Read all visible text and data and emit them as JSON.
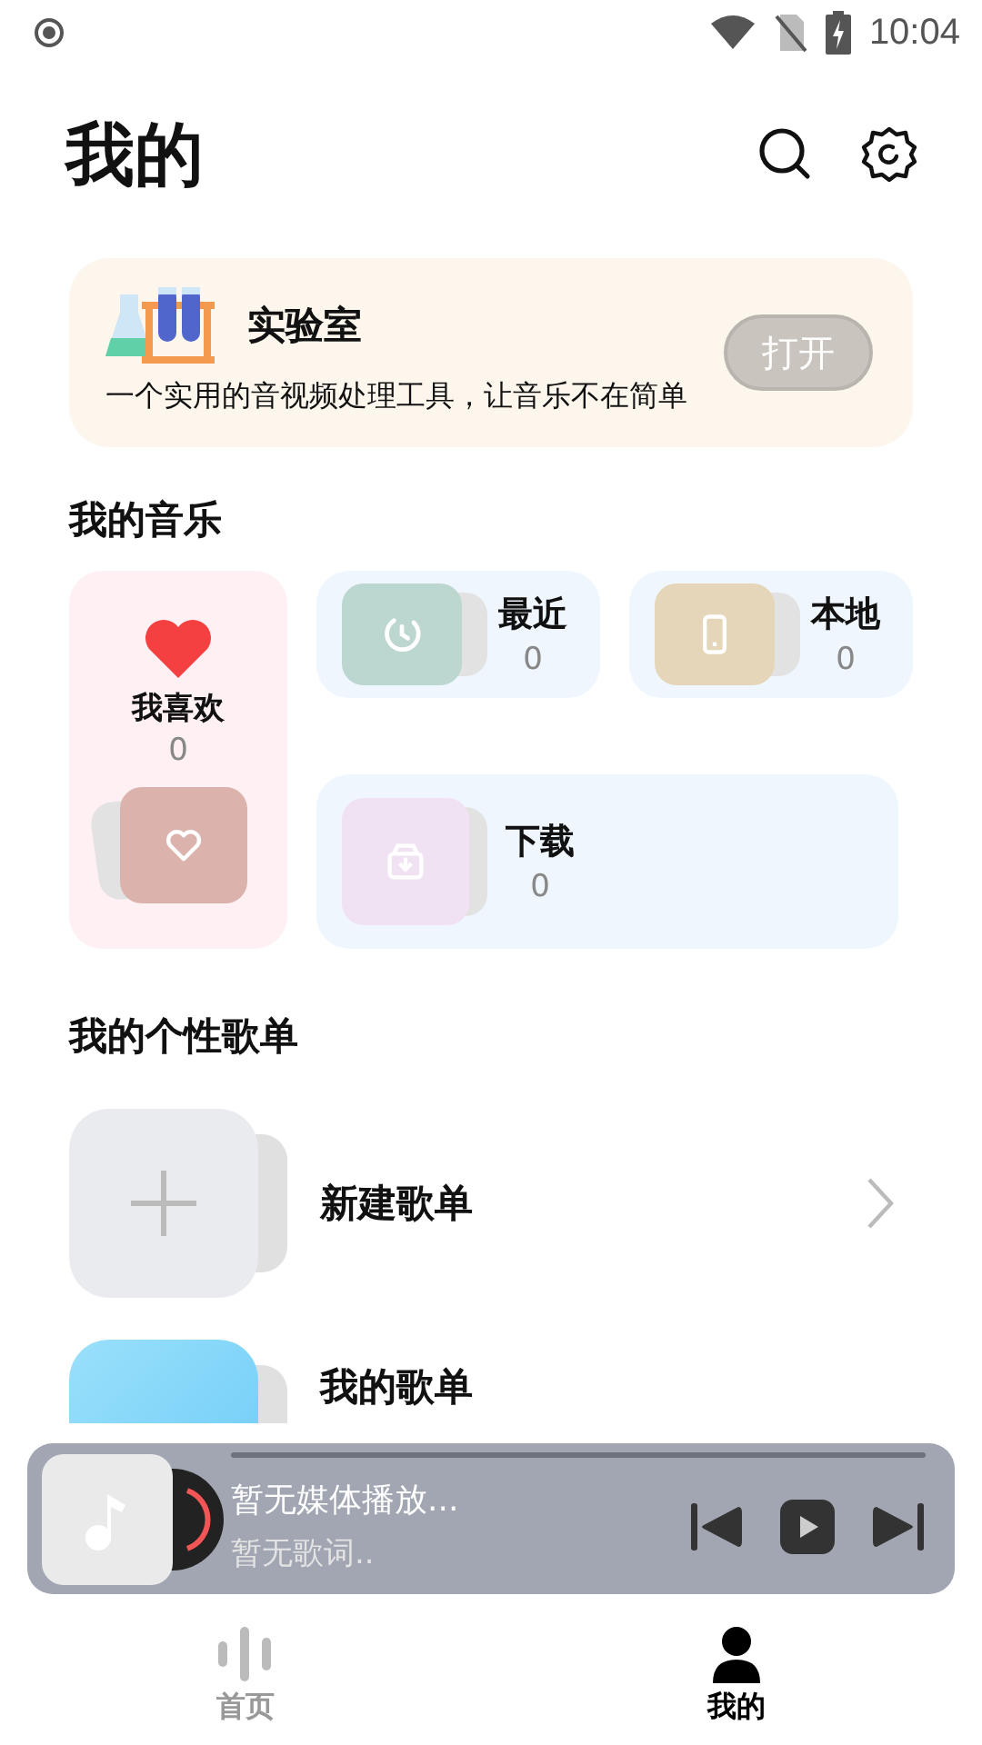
{
  "status_bar": {
    "time": "10:04"
  },
  "header": {
    "title": "我的"
  },
  "lab_card": {
    "title": "实验室",
    "description": "一个实用的音视频处理工具，让音乐不在简单",
    "button": "打开"
  },
  "music_section": {
    "title": "我的音乐",
    "tiles": [
      {
        "kind": "favorite",
        "name": "我喜欢",
        "count": "0",
        "color": "#dbb3ac"
      },
      {
        "kind": "recent",
        "name": "最近",
        "count": "0",
        "color": "#bcd6d0"
      },
      {
        "kind": "local",
        "name": "本地",
        "count": "0",
        "color": "#e6d6b9"
      },
      {
        "kind": "download",
        "name": "下载",
        "count": "0",
        "color": "#f1e2f3"
      }
    ]
  },
  "playlist_section": {
    "title": "我的个性歌单",
    "items": [
      {
        "kind": "create",
        "name": "新建歌单"
      },
      {
        "kind": "playlist",
        "name": "我的歌单"
      }
    ]
  },
  "player": {
    "title": "暂无媒体播放...",
    "lyric": "暂无歌词.."
  },
  "bottom_nav": [
    {
      "kind": "home",
      "label": "首页",
      "selected": false
    },
    {
      "kind": "profile",
      "label": "我的",
      "selected": true
    }
  ]
}
